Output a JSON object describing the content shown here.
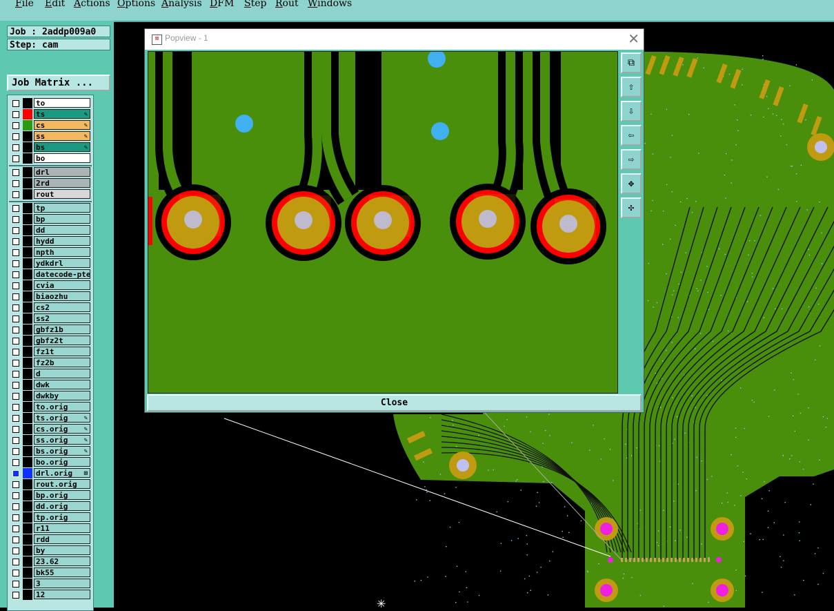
{
  "menu": [
    "File",
    "Edit",
    "Actions",
    "Options",
    "Analysis",
    "DFM",
    "Step",
    "Rout",
    "Windows"
  ],
  "job": {
    "job_line": "Job : 2addp009a0",
    "step_line": "Step: cam",
    "matrix_button": "Job Matrix ..."
  },
  "layers_group1": [
    {
      "name": "to",
      "color": "#000000",
      "bg": "#ffffff"
    },
    {
      "name": "ts",
      "color": "#ff0000",
      "bg": "#1a9a80",
      "mark": "✎"
    },
    {
      "name": "cs",
      "color": "#2a9a10",
      "bg": "#f4b860",
      "mark": "✎"
    },
    {
      "name": "ss",
      "color": "#000000",
      "bg": "#f4b860",
      "mark": "✎"
    },
    {
      "name": "bs",
      "color": "#000000",
      "bg": "#1a9a80",
      "mark": "✎"
    },
    {
      "name": "bo",
      "color": "#000000",
      "bg": "#ffffff"
    }
  ],
  "layers_group2": [
    {
      "name": "drl",
      "bg": "#a9b5b5"
    },
    {
      "name": "2rd",
      "bg": "#a9b5b5"
    },
    {
      "name": "rout",
      "bg": "#d7d7d7"
    }
  ],
  "layers_group3": [
    {
      "name": "tp"
    },
    {
      "name": "bp"
    },
    {
      "name": "dd"
    },
    {
      "name": "hydd"
    },
    {
      "name": "npth"
    },
    {
      "name": "ydkdrl"
    },
    {
      "name": "datecode-pte"
    },
    {
      "name": "cvia"
    },
    {
      "name": "biaozhu"
    },
    {
      "name": "cs2"
    },
    {
      "name": "ss2"
    },
    {
      "name": "gbfz1b"
    },
    {
      "name": "gbfz2t"
    },
    {
      "name": "fz1t"
    },
    {
      "name": "fz2b"
    },
    {
      "name": "d"
    },
    {
      "name": "dwk"
    },
    {
      "name": "dwkby"
    },
    {
      "name": "to.orig"
    },
    {
      "name": "ts.orig",
      "mark": "✎"
    },
    {
      "name": "cs.orig",
      "mark": "✎"
    },
    {
      "name": "ss.orig",
      "mark": "✎"
    },
    {
      "name": "bs.orig",
      "mark": "✎"
    },
    {
      "name": "bo.orig"
    },
    {
      "name": "drl.orig",
      "color": "#1030ff",
      "mark": "⊞",
      "selected": true
    },
    {
      "name": "rout.orig"
    },
    {
      "name": "bp.orig"
    },
    {
      "name": "dd.orig"
    },
    {
      "name": "tp.orig"
    },
    {
      "name": "r11"
    },
    {
      "name": "rdd"
    },
    {
      "name": "by"
    },
    {
      "name": "23.62"
    },
    {
      "name": "bk55"
    },
    {
      "name": "3"
    },
    {
      "name": "12"
    }
  ],
  "popview": {
    "title": "Popview - 1",
    "close_label": "Close",
    "close_x": "✕"
  },
  "popview_tools": [
    "fit-icon",
    "pan-up-icon",
    "pan-down-icon",
    "pan-left-icon",
    "pan-right-icon",
    "zoom-in-icon",
    "zoom-out-icon"
  ],
  "colors": {
    "board_green": "#4a8f0b",
    "pad_gold": "#c09a10",
    "mask_red": "#ff0000",
    "via_blue": "#40b0f0",
    "drill_lilac": "#c0c0f0",
    "pin_magenta": "#f020e0",
    "panel_teal": "#5ec8b1"
  }
}
